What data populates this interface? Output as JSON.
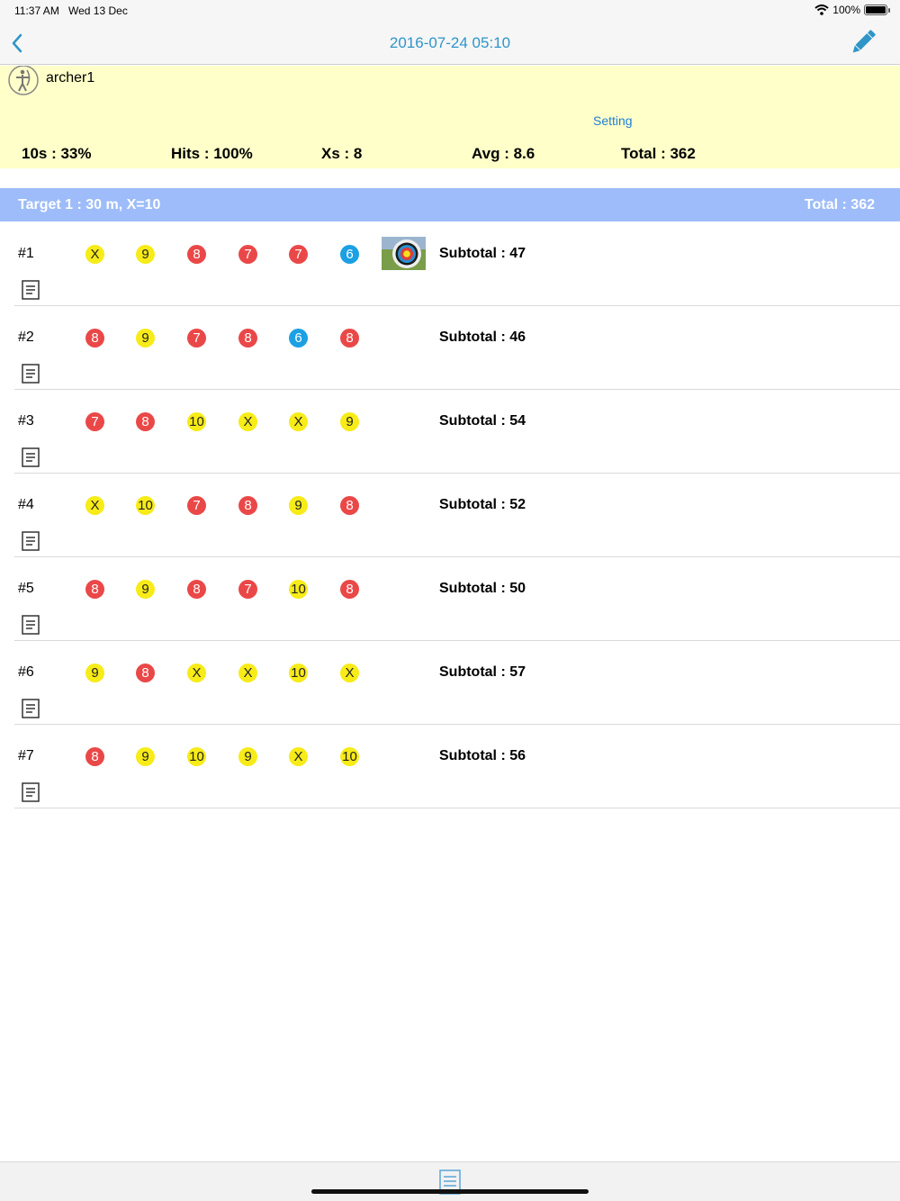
{
  "status_bar": {
    "time": "11:37 AM",
    "date": "Wed 13 Dec",
    "battery": "100%",
    "battery_level": 1.0
  },
  "nav": {
    "title": "2016-07-24  05:10",
    "back_icon": "chevron-left-icon",
    "edit_icon": "pencil-icon",
    "accent": "#2e95c8"
  },
  "archer": {
    "name": "archer1",
    "avatar_icon": "archer-icon"
  },
  "setting_label": "Setting",
  "stats": [
    {
      "label": "10s : 33%"
    },
    {
      "label": "Hits : 100%"
    },
    {
      "label": "Xs : 8"
    },
    {
      "label": "Avg : 8.6"
    },
    {
      "label": "Total : 362"
    }
  ],
  "target": {
    "title": "Target 1 : 30 m, X=10",
    "total": "Total : 362"
  },
  "colors": {
    "yellow": "#f7eb18",
    "red": "#ea4848",
    "blue": "#1ca0e4",
    "summary_bg": "#ffffc9",
    "target_bg": "#9dbcf9"
  },
  "ends": [
    {
      "no": "#1",
      "arrows": [
        "X",
        "9",
        "8",
        "7",
        "7",
        "6"
      ],
      "subtotal": "Subtotal : 47",
      "has_photo": true
    },
    {
      "no": "#2",
      "arrows": [
        "8",
        "9",
        "7",
        "8",
        "6",
        "8"
      ],
      "subtotal": "Subtotal : 46",
      "has_photo": false
    },
    {
      "no": "#3",
      "arrows": [
        "7",
        "8",
        "10",
        "X",
        "X",
        "9"
      ],
      "subtotal": "Subtotal : 54",
      "has_photo": false
    },
    {
      "no": "#4",
      "arrows": [
        "X",
        "10",
        "7",
        "8",
        "9",
        "8"
      ],
      "subtotal": "Subtotal : 52",
      "has_photo": false
    },
    {
      "no": "#5",
      "arrows": [
        "8",
        "9",
        "8",
        "7",
        "10",
        "8"
      ],
      "subtotal": "Subtotal : 50",
      "has_photo": false
    },
    {
      "no": "#6",
      "arrows": [
        "9",
        "8",
        "X",
        "X",
        "10",
        "X"
      ],
      "subtotal": "Subtotal : 57",
      "has_photo": false
    },
    {
      "no": "#7",
      "arrows": [
        "8",
        "9",
        "10",
        "9",
        "X",
        "10"
      ],
      "subtotal": "Subtotal : 56",
      "has_photo": false
    }
  ],
  "bottom_bar": {
    "icon": "document-icon"
  }
}
